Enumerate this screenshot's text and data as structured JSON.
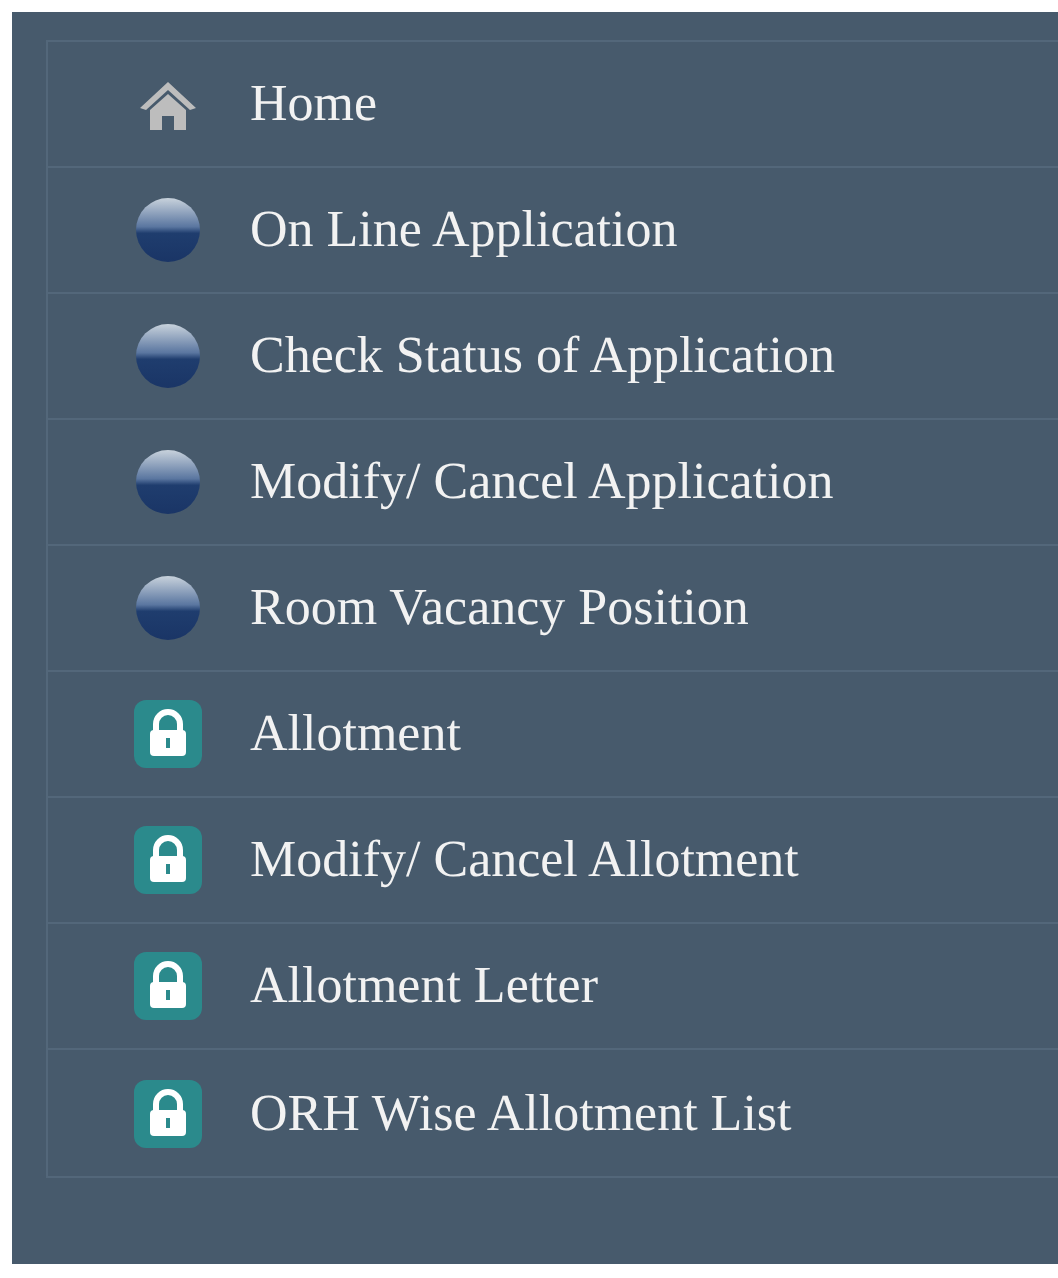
{
  "menu": {
    "items": [
      {
        "label": "Home",
        "kind": "home"
      },
      {
        "label": "On Line Application",
        "kind": "bullet"
      },
      {
        "label": "Check Status of Application",
        "kind": "bullet"
      },
      {
        "label": "Modify/ Cancel Application",
        "kind": "bullet"
      },
      {
        "label": "Room Vacancy Position",
        "kind": "bullet"
      },
      {
        "label": "Allotment",
        "kind": "lock"
      },
      {
        "label": "Modify/ Cancel Allotment",
        "kind": "lock"
      },
      {
        "label": "Allotment Letter",
        "kind": "lock"
      },
      {
        "label": "ORH Wise Allotment List",
        "kind": "lock"
      }
    ]
  }
}
